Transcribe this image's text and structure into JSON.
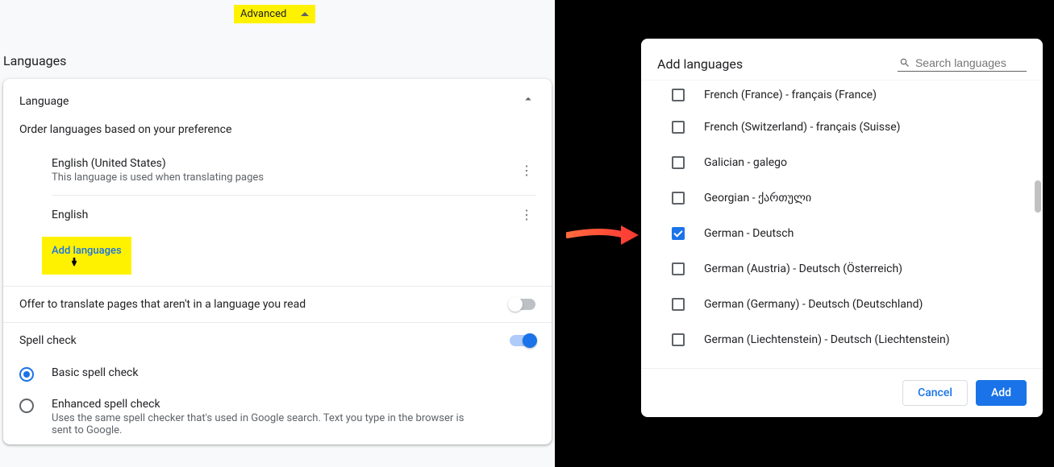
{
  "advanced_label": "Advanced",
  "section_title": "Languages",
  "card": {
    "title": "Language",
    "order_text": "Order languages based on your preference",
    "languages": [
      {
        "name": "English (United States)",
        "desc": "This language is used when translating pages"
      },
      {
        "name": "English",
        "desc": ""
      }
    ],
    "add_label": "Add languages",
    "translate_label": "Offer to translate pages that aren't in a language you read",
    "spellcheck_label": "Spell check",
    "spell_options": {
      "basic": {
        "label": "Basic spell check"
      },
      "enhanced": {
        "label": "Enhanced spell check",
        "desc": "Uses the same spell checker that's used in Google search. Text you type in the browser is sent to Google."
      }
    }
  },
  "dialog": {
    "title": "Add languages",
    "search_placeholder": "Search languages",
    "items": [
      {
        "label": "French (France) - français (France)",
        "checked": false
      },
      {
        "label": "French (Switzerland) - français (Suisse)",
        "checked": false
      },
      {
        "label": "Galician - galego",
        "checked": false
      },
      {
        "label": "Georgian - ქართული",
        "checked": false
      },
      {
        "label": "German - Deutsch",
        "checked": true
      },
      {
        "label": "German (Austria) - Deutsch (Österreich)",
        "checked": false
      },
      {
        "label": "German (Germany) - Deutsch (Deutschland)",
        "checked": false
      },
      {
        "label": "German (Liechtenstein) - Deutsch (Liechtenstein)",
        "checked": false
      }
    ],
    "cancel": "Cancel",
    "add": "Add"
  }
}
